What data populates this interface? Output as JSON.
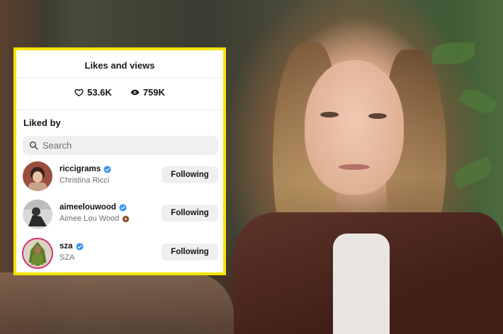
{
  "panel": {
    "title": "Likes and views",
    "likes": "53.6K",
    "views": "759K",
    "section_label": "Liked by",
    "search_placeholder": "Search"
  },
  "users": [
    {
      "username": "riccigrams",
      "full_name": "Christina Ricci",
      "verified": true,
      "button": "Following",
      "name_emoji": ""
    },
    {
      "username": "aimeelouwood",
      "full_name": "Aimee Lou Wood",
      "verified": true,
      "button": "Following",
      "name_emoji": "donut"
    },
    {
      "username": "sza",
      "full_name": "SZA",
      "verified": true,
      "button": "Following",
      "name_emoji": "",
      "story_ring": true
    }
  ],
  "colors": {
    "border_highlight": "#f5e400",
    "verified_blue": "#3897f0",
    "story_ring": "#d6286d"
  }
}
